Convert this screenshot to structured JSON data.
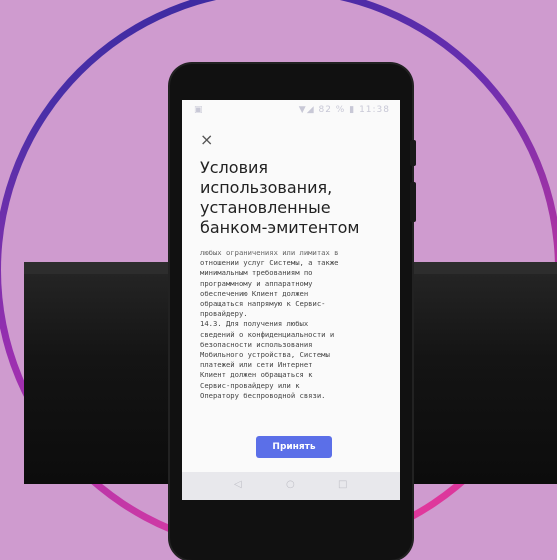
{
  "status_bar": {
    "left_icon": "image-notification-icon",
    "battery_percent": "82 %",
    "time": "11:38"
  },
  "dialog": {
    "close_label": "×",
    "title": "Условия использования, установленные банком-эмитентом",
    "body": "любых ограничениях или лимитах в\nотношении услуг Системы, а также\nминимальным требованиям по\nпрограммному и аппаратному\nобеспечению Клиент должен\nобращаться напрямую к Сервис-\nпровайдеру.\n14.3. Для получения любых\nсведений о конфиденциальности и\nбезопасности использования\nМобильного устройства, Системы\nплатежей или сети Интернет\nКлиент должен обращаться к\nСервис-провайдеру или к\nОператору беспроводной связи.",
    "accept_label": "Принять"
  },
  "nav_bar": {
    "back": "◁",
    "home": "○",
    "recents": "□"
  },
  "colors": {
    "background": "#cf9bcf",
    "accent_button": "#5b6fe8"
  }
}
